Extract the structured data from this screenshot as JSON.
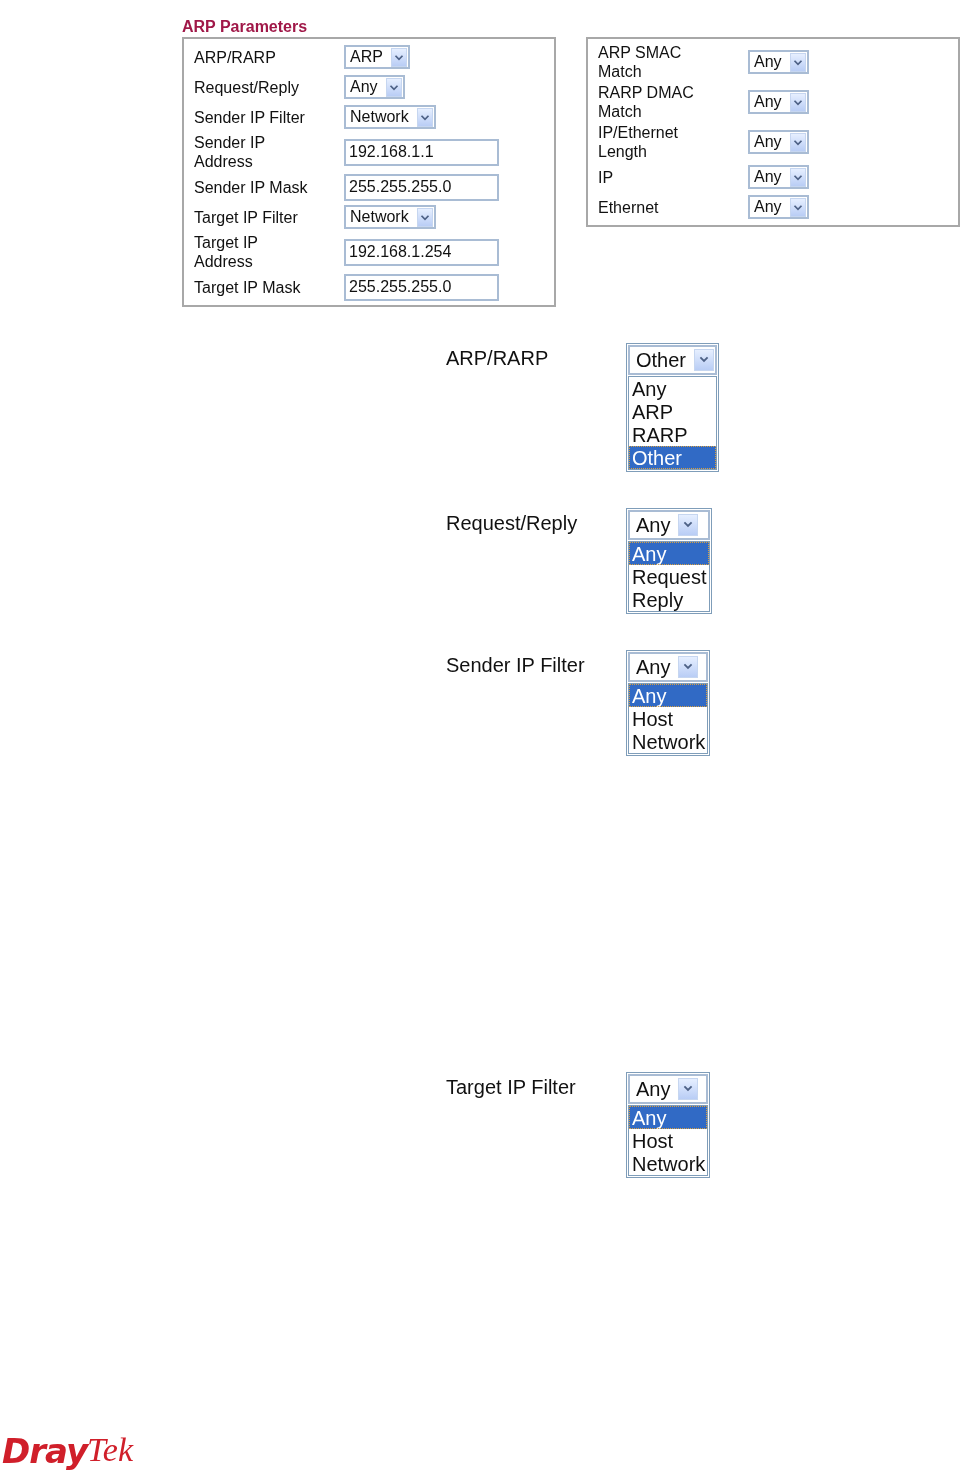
{
  "section_title": "ARP Parameters",
  "left_rows": [
    {
      "label": "ARP/RARP",
      "kind": "select",
      "value": "ARP"
    },
    {
      "label": "Request/Reply",
      "kind": "select",
      "value": "Any"
    },
    {
      "label": "Sender IP Filter",
      "kind": "select",
      "value": "Network"
    },
    {
      "label": "Sender IP\nAddress",
      "kind": "input",
      "value": "192.168.1.1"
    },
    {
      "label": "Sender IP Mask",
      "kind": "input",
      "value": "255.255.255.0"
    },
    {
      "label": "Target IP Filter",
      "kind": "select",
      "value": "Network"
    },
    {
      "label": "Target IP\nAddress",
      "kind": "input",
      "value": "192.168.1.254"
    },
    {
      "label": "Target IP Mask",
      "kind": "input",
      "value": "255.255.255.0"
    }
  ],
  "right_rows": [
    {
      "label": "ARP SMAC\nMatch",
      "kind": "select",
      "value": "Any"
    },
    {
      "label": "RARP DMAC\nMatch",
      "kind": "select",
      "value": "Any"
    },
    {
      "label": "IP/Ethernet\nLength",
      "kind": "select",
      "value": "Any"
    },
    {
      "label": "IP",
      "kind": "select",
      "value": "Any"
    },
    {
      "label": "Ethernet",
      "kind": "select",
      "value": "Any"
    }
  ],
  "dropdown_examples": [
    {
      "label": "ARP/RARP",
      "value": "Other",
      "options": [
        {
          "text": "Any",
          "selected": false
        },
        {
          "text": "ARP",
          "selected": false
        },
        {
          "text": "RARP",
          "selected": false
        },
        {
          "text": "Other",
          "selected": true
        }
      ]
    },
    {
      "label": "Request/Reply",
      "value": "Any",
      "options": [
        {
          "text": "Any",
          "selected": true
        },
        {
          "text": "Request",
          "selected": false
        },
        {
          "text": "Reply",
          "selected": false
        }
      ]
    },
    {
      "label": "Sender IP Filter",
      "value": "Any",
      "options": [
        {
          "text": "Any",
          "selected": true
        },
        {
          "text": "Host",
          "selected": false
        },
        {
          "text": "Network",
          "selected": false
        }
      ]
    },
    {
      "label": "Target IP Filter",
      "value": "Any",
      "options": [
        {
          "text": "Any",
          "selected": true
        },
        {
          "text": "Host",
          "selected": false
        },
        {
          "text": "Network",
          "selected": false
        }
      ]
    }
  ],
  "logo": {
    "parts": [
      "Dray",
      "Tek"
    ]
  }
}
